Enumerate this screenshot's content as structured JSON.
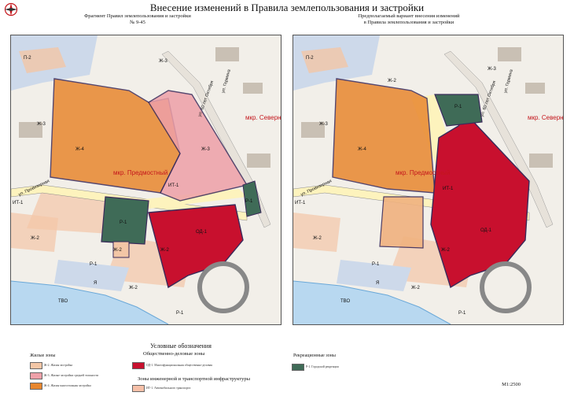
{
  "title": "Внесение изменений в Правила землепользования и застройки",
  "left_map": {
    "caption": "Фрагмент Правил землепользования и застройки\n№ 9-45",
    "labels": {
      "zh4": "Ж-4",
      "zh3a": "Ж-3",
      "zh3b": "Ж-3",
      "zh3c": "Ж-3",
      "zh2a": "Ж-2",
      "zh2b": "Ж-2",
      "zh2c": "Ж-2",
      "zh2d": "Ж-2",
      "it1a": "ИТ-1",
      "it1b": "ИТ-1",
      "p1a": "Р-1",
      "p1b": "Р-1",
      "p1c": "Р-1",
      "p1d": "Р-1",
      "od1": "ОД-1",
      "p2": "П-2",
      "tvo": "ТВО",
      "ya": "Я",
      "district": "мкр. Предмостный",
      "north": "мкр. Северн",
      "street_oct": "ул. 60 лет Октября",
      "street_ger": "ул. Гермина",
      "street_prov": "ул. Провизорная"
    }
  },
  "right_map": {
    "caption": "Предполагаемый вариант внесения изменений\nв Правила землепользования и застройки",
    "labels": {
      "zh4": "Ж-4",
      "zh3a": "Ж-3",
      "zh3b": "Ж-3",
      "zh2a": "Ж-2",
      "zh2b": "Ж-2",
      "zh2c": "Ж-2",
      "zh2d": "Ж-2",
      "it1a": "ИТ-1",
      "it1b": "ИТ-1",
      "p1a": "Р-1",
      "p1b": "Р-1",
      "p1c": "Р-1",
      "od1": "ОД-1",
      "p2": "П-2",
      "tvo": "ТВО",
      "ya": "Я",
      "district": "мкр. Предмостный",
      "north": "мкр. Северн",
      "street_oct": "ул. 60 лет Октября",
      "street_ger": "ул. Гермина",
      "street_prov": "ул. Провизорная"
    }
  },
  "legend": {
    "title": "Условные обозначения",
    "residential_title": "Жилые зоны",
    "business_title": "Общественно-деловые зоны",
    "engineering_title": "Зоны инженерной и транспортной инфраструктуры",
    "recreation_title": "Рекреационные зоны",
    "residential_items": [
      "Ж-2. Жилая застройка",
      "Ж-3. Жилые застройки средней этажности",
      "Ж-4. Жилая многоэтажная застройка"
    ],
    "business_item": "ОД-1. Многофункциональная общественно-деловая",
    "engineering_item": "ИТ-1. Автомобильного транспорта",
    "recreation_item": "Р-1. Городской рекреации"
  },
  "scale": "M1:2500",
  "colors": {
    "zh4": "#e8872f",
    "zh3": "#eea0a8",
    "zh2": "#f3c6a6",
    "od1": "#c8102e",
    "it1": "#fdf3bd",
    "p1": "#3f6b57",
    "water": "#b8d8f0",
    "block": "#c9c0b4"
  }
}
